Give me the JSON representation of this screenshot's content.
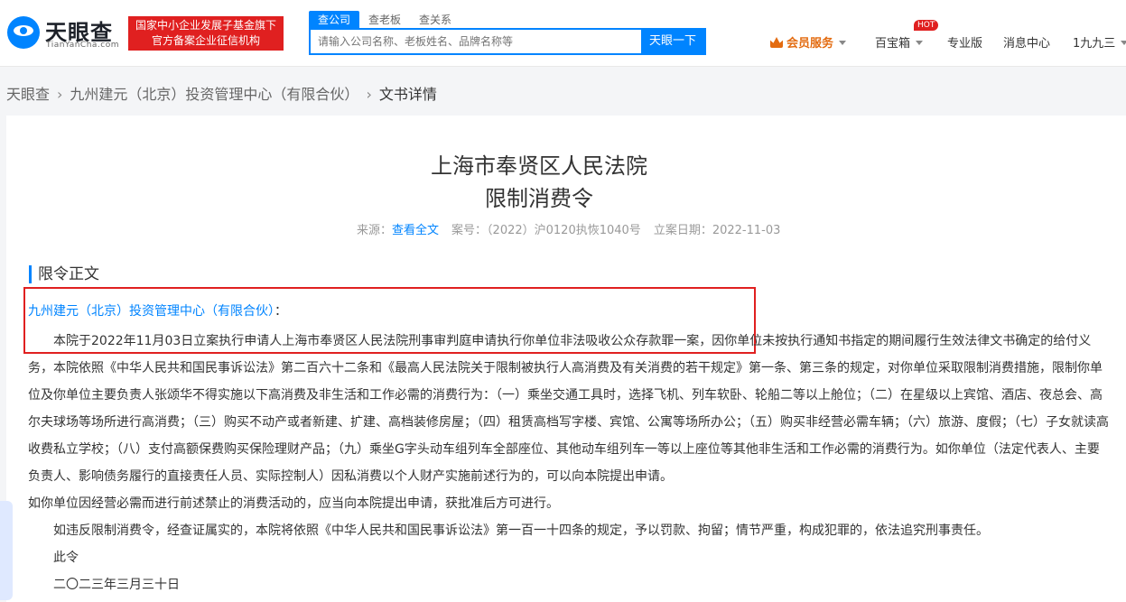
{
  "header": {
    "logo_name": "天眼查",
    "logo_url": "TianYanCha.com",
    "badge_line1": "国家中小企业发展子基金旗下",
    "badge_line2": "官方备案企业征信机构",
    "search_tabs": [
      "查公司",
      "查老板",
      "查关系"
    ],
    "search_placeholder": "请输入公司名称、老板姓名、品牌名称等",
    "search_button": "天眼一下",
    "vip": "会员服务",
    "baibao": "百宝箱",
    "hot": "HOT",
    "pro": "专业版",
    "messages": "消息中心",
    "user": "1九九三"
  },
  "breadcrumb": {
    "home": "天眼查",
    "company": "九州建元（北京）投资管理中心（有限合伙）",
    "current": "文书详情"
  },
  "document": {
    "court": "上海市奉贤区人民法院",
    "doc_type": "限制消费令",
    "source_label": "来源：",
    "source_link": "查看全文",
    "case_label": "案号：",
    "case_no": "（2022）沪0120执恢1040号",
    "date_label": "立案日期：",
    "date": "2022-11-03",
    "section": "限令正文",
    "party": "九州建元（北京）投资管理中心（有限合伙）",
    "party_suffix": "：",
    "para1": "本院于2022年11月03日立案执行申请人上海市奉贤区人民法院刑事审判庭申请执行你单位非法吸收公众存款罪一案，因你单位未按执行通知书指定的期间履行生效法律文书确定的给付义务，本院依照《中华人民共和国民事诉讼法》第二百六十二条和《最高人民法院关于限制被执行人高消费及有关消费的若干规定》第一条、第三条的规定，对你单位采取限制消费措施，限制你单位及你单位主要负责人张颂华不得实施以下高消费及非生活和工作必需的消费行为：（一）乘坐交通工具时，选择飞机、列车软卧、轮船二等以上舱位；（二）在星级以上宾馆、酒店、夜总会、高尔夫球场等场所进行高消费；（三）购买不动产或者新建、扩建、高档装修房屋；（四）租赁高档写字楼、宾馆、公寓等场所办公；（五）购买非经营必需车辆；（六）旅游、度假；（七）子女就读高收费私立学校；（八）支付高额保费购买保险理财产品；（九）乘坐G字头动车组列车全部座位、其他动车组列车一等以上座位等其他非生活和工作必需的消费行为。如你单位（法定代表人、主要负责人、影响债务履行的直接责任人员、实际控制人）因私消费以个人财产实施前述行为的，可以向本院提出申请。",
    "para2": "如你单位因经营必需而进行前述禁止的消费活动的，应当向本院提出申请，获批准后方可进行。",
    "para3": "如违反限制消费令，经查证属实的，本院将依照《中华人民共和国民事诉讼法》第一百一十四条的规定，予以罚款、拘留；情节严重，构成犯罪的，依法追究刑事责任。",
    "para4": "此令",
    "para5": "二〇二三年三月三十日"
  }
}
